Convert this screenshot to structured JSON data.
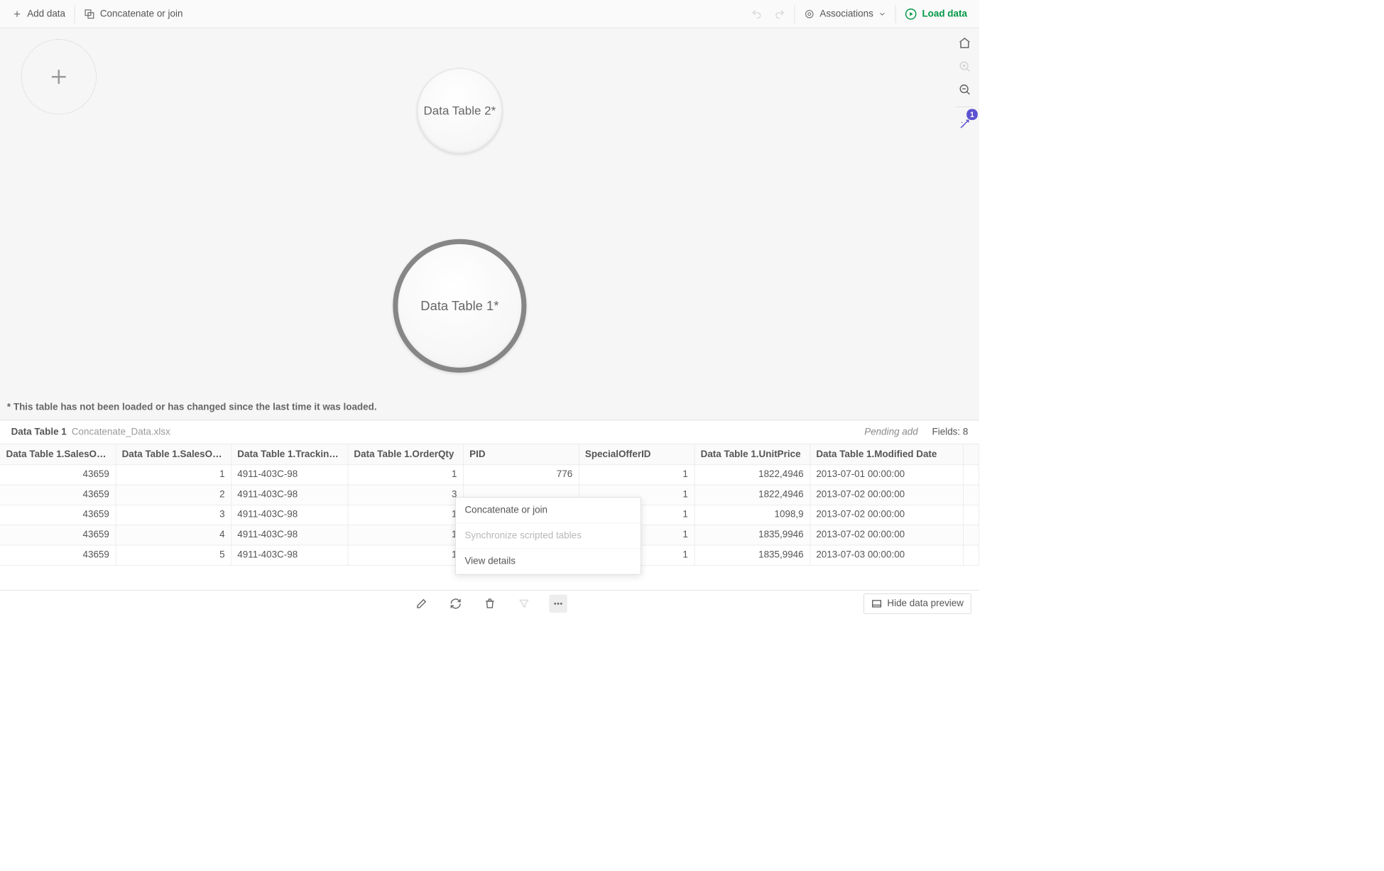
{
  "toolbar": {
    "addData": "Add data",
    "concatJoin": "Concatenate or join",
    "associations": "Associations",
    "loadData": "Load data"
  },
  "canvas": {
    "bubble2": "Data Table 2*",
    "bubble1": "Data Table 1*",
    "note": "* This table has not been loaded or has changed since the last time it was loaded."
  },
  "rail": {
    "badge": "1"
  },
  "previewHeader": {
    "title": "Data Table 1",
    "file": "Concatenate_Data.xlsx",
    "pending": "Pending add",
    "fieldsLabel": "Fields: 8"
  },
  "columns": [
    "Data Table 1.SalesOr…",
    "Data Table 1.SalesOr…",
    "Data Table 1.Tracking…",
    "Data Table 1.OrderQty",
    "PID",
    "SpecialOfferID",
    "Data Table 1.UnitPrice",
    "Data Table 1.Modified Date"
  ],
  "colNumeric": [
    true,
    true,
    false,
    true,
    true,
    true,
    true,
    false
  ],
  "rows": [
    [
      "43659",
      "1",
      "4911-403C-98",
      "1",
      "776",
      "1",
      "1822,4946",
      "2013-07-01 00:00:00"
    ],
    [
      "43659",
      "2",
      "4911-403C-98",
      "3",
      "",
      "1",
      "1822,4946",
      "2013-07-02 00:00:00"
    ],
    [
      "43659",
      "3",
      "4911-403C-98",
      "1",
      "",
      "1",
      "1098,9",
      "2013-07-02 00:00:00"
    ],
    [
      "43659",
      "4",
      "4911-403C-98",
      "1",
      "",
      "1",
      "1835,9946",
      "2013-07-02 00:00:00"
    ],
    [
      "43659",
      "5",
      "4911-403C-98",
      "1",
      "",
      "1",
      "1835,9946",
      "2013-07-03 00:00:00"
    ]
  ],
  "contextMenu": {
    "concat": "Concatenate or join",
    "sync": "Synchronize scripted tables",
    "details": "View details"
  },
  "bottom": {
    "hidePreview": "Hide data preview"
  }
}
